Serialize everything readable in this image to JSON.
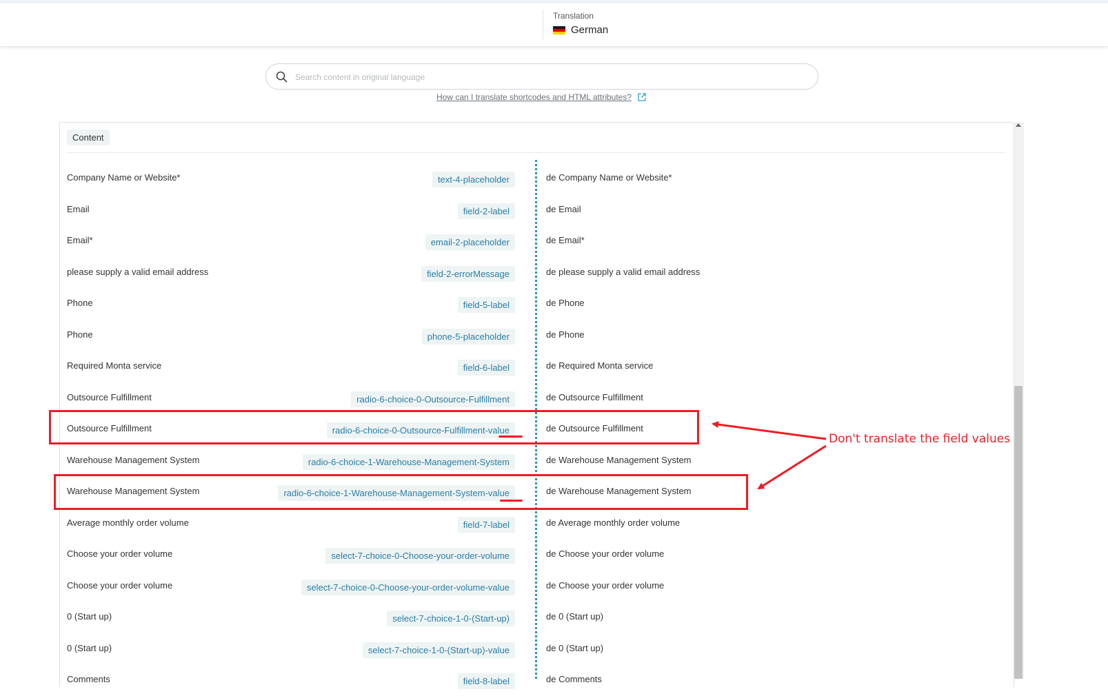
{
  "header": {
    "translation_label": "Translation",
    "language": "German"
  },
  "search": {
    "placeholder": "Search content in original language",
    "value": ""
  },
  "help_link": "How can I translate shortcodes and HTML attributes?",
  "panel": {
    "tab_label": "Content"
  },
  "rows": [
    {
      "original": "Company Name or Website*",
      "key": "text-4-placeholder",
      "translation": "de Company Name or Website*"
    },
    {
      "original": "Email",
      "key": "field-2-label",
      "translation": "de Email"
    },
    {
      "original": "Email*",
      "key": "email-2-placeholder",
      "translation": "de Email*"
    },
    {
      "original": "please supply a valid email address",
      "key": "field-2-errorMessage",
      "translation": "de please supply a valid email address"
    },
    {
      "original": "Phone",
      "key": "field-5-label",
      "translation": "de Phone"
    },
    {
      "original": "Phone",
      "key": "phone-5-placeholder",
      "translation": "de Phone"
    },
    {
      "original": "Required Monta service",
      "key": "field-6-label",
      "translation": "de Required Monta service"
    },
    {
      "original": "Outsource Fulfillment",
      "key": "radio-6-choice-0-Outsource-Fulfillment",
      "translation": "de Outsource Fulfillment"
    },
    {
      "original": "Outsource Fulfillment",
      "key": "radio-6-choice-0-Outsource-Fulfillment-value",
      "translation": "de Outsource Fulfillment"
    },
    {
      "original": "Warehouse Management System",
      "key": "radio-6-choice-1-Warehouse-Management-System",
      "translation": "de Warehouse Management System"
    },
    {
      "original": "Warehouse Management System",
      "key": "radio-6-choice-1-Warehouse-Management-System-value",
      "translation": "de Warehouse Management System"
    },
    {
      "original": "Average monthly order volume",
      "key": "field-7-label",
      "translation": "de Average monthly order volume"
    },
    {
      "original": "Choose your order volume",
      "key": "select-7-choice-0-Choose-your-order-volume",
      "translation": "de Choose your order volume"
    },
    {
      "original": "Choose your order volume",
      "key": "select-7-choice-0-Choose-your-order-volume-value",
      "translation": "de Choose your order volume"
    },
    {
      "original": "0 (Start up)",
      "key": "select-7-choice-1-0-(Start-up)",
      "translation": "de 0 (Start up)"
    },
    {
      "original": "0 (Start up)",
      "key": "select-7-choice-1-0-(Start-up)-value",
      "translation": "de 0 (Start up)"
    },
    {
      "original": "Comments",
      "key": "field-8-label",
      "translation": "de Comments"
    }
  ],
  "annotation": {
    "text": "Don't translate the field values",
    "color": "#ee1c24"
  },
  "colors": {
    "key_text": "#2a7fa5",
    "divider": "#2f8fb5",
    "key_bg": "#eef3f4"
  }
}
